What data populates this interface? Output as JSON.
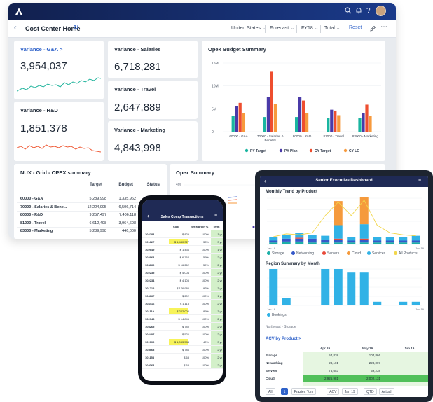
{
  "desktop": {
    "header": {
      "search_icon": "search-icon",
      "bell_icon": "bell-icon",
      "help": "?"
    },
    "subbar": {
      "title": "Cost Center Home",
      "filters": [
        "United States",
        "Forecast",
        "FY18",
        "Total"
      ],
      "reset": "Reset"
    },
    "tiles": {
      "ga": {
        "title": "Variance - G&A >",
        "value": "3,954,037"
      },
      "rd": {
        "title": "Variance - R&D",
        "value": "1,851,378"
      },
      "salaries": {
        "title": "Variance - Salaries",
        "value": "6,718,281"
      },
      "travel": {
        "title": "Variance - Travel",
        "value": "2,647,889"
      },
      "marketing": {
        "title": "Variance - Marketing",
        "value": "4,843,998"
      }
    },
    "opex_budget": {
      "title": "Opex Budget Summary",
      "chart_data": {
        "type": "bar",
        "title": "Opex Budget Summary",
        "categories": [
          "60000 - G&A",
          "70000 - Salaries & Benefits",
          "80000 - R&D",
          "81000 - Travel",
          "83000 - Marketing"
        ],
        "yticks": [
          "15M",
          "10M",
          "5M",
          "0"
        ],
        "ylim": [
          0,
          15
        ],
        "series": [
          {
            "name": "PY Target",
            "color": "#19b5a0",
            "values": [
              3.5,
              3.2,
              3.2,
              3.0,
              3.0
            ]
          },
          {
            "name": "PY Plan",
            "color": "#4a3aa8",
            "values": [
              5.6,
              7.5,
              7.5,
              4.8,
              4.0
            ]
          },
          {
            "name": "CY Target",
            "color": "#ee4e2f",
            "values": [
              6.3,
              13.1,
              6.8,
              4.6,
              5.9
            ]
          },
          {
            "name": "CY LE",
            "color": "#f79a3d",
            "values": [
              4.0,
              6.0,
              4.0,
              3.6,
              3.5
            ]
          }
        ]
      }
    },
    "nux": {
      "title": "NUX - Grid - OPEX summary",
      "columns": [
        "Target",
        "Budget",
        "Status"
      ],
      "rows": [
        {
          "label": "60000 - G&A",
          "target": "5,289,998",
          "budget": "1,335,962"
        },
        {
          "label": "70000 - Salaries & Bene...",
          "target": "12,224,995",
          "budget": "6,506,714"
        },
        {
          "label": "80000 - R&D",
          "target": "9,257,497",
          "budget": "7,406,118"
        },
        {
          "label": "81000 - Travel",
          "target": "6,612,498",
          "budget": "3,964,608"
        },
        {
          "label": "83000 - Marketing",
          "target": "5,289,998",
          "budget": "446,000"
        }
      ]
    },
    "opex_summary": {
      "title": "Opex Summary",
      "axis_label": "4M"
    }
  },
  "tablet": {
    "title": "Senior Executive Dashboard",
    "monthly": {
      "title": "Monthly Trend by Product",
      "x_start": "Jan 19",
      "x_end": "Jun 19",
      "legend": [
        "Storage",
        "Networking",
        "Servers",
        "Cloud",
        "Services",
        "All Products"
      ],
      "legend_colors": [
        "#1db0a8",
        "#3558c9",
        "#e84a3a",
        "#f59a3c",
        "#31b2e6",
        "#f2d64b"
      ],
      "chart_data": {
        "type": "bar",
        "title": "Monthly Trend by Product",
        "note": "stacked monthly values, relative units",
        "series": [
          {
            "name": "Storage",
            "values": [
              2,
              3,
              3,
              2,
              2,
              2,
              2,
              2,
              2,
              2,
              2,
              2
            ]
          },
          {
            "name": "Networking",
            "values": [
              2,
              3,
              3,
              4,
              3,
              3,
              2,
              3,
              2,
              2,
              2,
              2
            ]
          },
          {
            "name": "Servers",
            "values": [
              0,
              0,
              1,
              0,
              0,
              1,
              0,
              1,
              0,
              0,
              0,
              0
            ]
          },
          {
            "name": "Cloud",
            "values": [
              0,
              0,
              0,
              0,
              0,
              25,
              0,
              28,
              0,
              0,
              0,
              0
            ]
          },
          {
            "name": "Services",
            "values": [
              4,
              4,
              5,
              4,
              4,
              14,
              4,
              15,
              4,
              4,
              4,
              5
            ]
          },
          {
            "name": "All Products",
            "values": [
              8,
              11,
              10,
              12,
              30,
              44,
              30,
              46,
              20,
              12,
              10,
              9
            ]
          }
        ]
      }
    },
    "region": {
      "title": "Region Summary by Month",
      "x_start": "Jan 19",
      "x_end": "Jun 19",
      "legend": "Bookings",
      "filter_chip": "Northeast - Storage",
      "chart_data": {
        "type": "bar",
        "series": [
          {
            "name": "Bookings",
            "values": [
              10,
              2,
              0,
              0,
              10,
              10,
              9,
              9,
              1,
              0,
              1,
              1
            ]
          }
        ]
      }
    },
    "acv": {
      "title": "ACV by Product >",
      "columns": [
        "Apr 19",
        "May 19",
        "Jun 19"
      ],
      "rows": [
        {
          "label": "Storage",
          "values": [
            "54,838",
            "104,866",
            ""
          ]
        },
        {
          "label": "Networking",
          "values": [
            "28,101",
            "228,007",
            ""
          ]
        },
        {
          "label": "Servers",
          "values": [
            "76,653",
            "59,238",
            ""
          ]
        },
        {
          "label": "Cloud",
          "values": [
            "2,926,981",
            "2,002,131",
            ""
          ]
        }
      ]
    },
    "bottom_tabs": [
      "All",
      "1",
      "Frazier, Tom",
      "ACV",
      "Jan 19",
      "QTD",
      "Actual"
    ]
  },
  "phone": {
    "title": "Sales Comp Transactions",
    "columns": [
      "Cost",
      "Net Margin %",
      "Term"
    ],
    "rows": [
      {
        "id": "104284",
        "cost": "$ 829",
        "margin": "100%",
        "term": "1 yr",
        "hl": false
      },
      {
        "id": "101827",
        "cost": "$ 1,440,327",
        "margin": "38%",
        "term": "3 yr",
        "hl": true
      },
      {
        "id": "102649",
        "cost": "$ 1,436",
        "margin": "100%",
        "term": "1 yr",
        "hl": false
      },
      {
        "id": "103864",
        "cost": "$ 6,764",
        "margin": "59%",
        "term": "2 yr",
        "hl": false
      },
      {
        "id": "103869",
        "cost": "$ 16,262",
        "margin": "59%",
        "term": "2 yr",
        "hl": false
      },
      {
        "id": "102235",
        "cost": "$ 4,004",
        "margin": "100%",
        "term": "2 yr",
        "hl": false
      },
      {
        "id": "102234",
        "cost": "$ 4,105",
        "margin": "100%",
        "term": "2 yr",
        "hl": false
      },
      {
        "id": "101712",
        "cost": "$ 176,980",
        "margin": "92%",
        "term": "3 yr",
        "hl": false
      },
      {
        "id": "104667",
        "cost": "$ 202",
        "margin": "100%",
        "term": "1 yr",
        "hl": false
      },
      {
        "id": "104416",
        "cost": "$ 1,115",
        "margin": "100%",
        "term": "2 yr",
        "hl": false
      },
      {
        "id": "101119",
        "cost": "$ 222,000",
        "margin": "89%",
        "term": "3 yr",
        "hl": true
      },
      {
        "id": "102348",
        "cost": "$ 14,846",
        "margin": "100%",
        "term": "2 yr",
        "hl": false
      },
      {
        "id": "105265",
        "cost": "$ 740",
        "margin": "100%",
        "term": "2 yr",
        "hl": false
      },
      {
        "id": "104407",
        "cost": "$ 526",
        "margin": "100%",
        "term": "2 yr",
        "hl": false
      },
      {
        "id": "101709",
        "cost": "$ 1,033,584",
        "margin": "40%",
        "term": "3 yr",
        "hl": true
      },
      {
        "id": "103663",
        "cost": "$ 786",
        "margin": "100%",
        "term": "2 yr",
        "hl": false
      },
      {
        "id": "101158",
        "cost": "$ 63",
        "margin": "100%",
        "term": "2 yr",
        "hl": false
      },
      {
        "id": "104064",
        "cost": "$ 63",
        "margin": "100%",
        "term": "2 yr",
        "hl": false
      }
    ]
  }
}
